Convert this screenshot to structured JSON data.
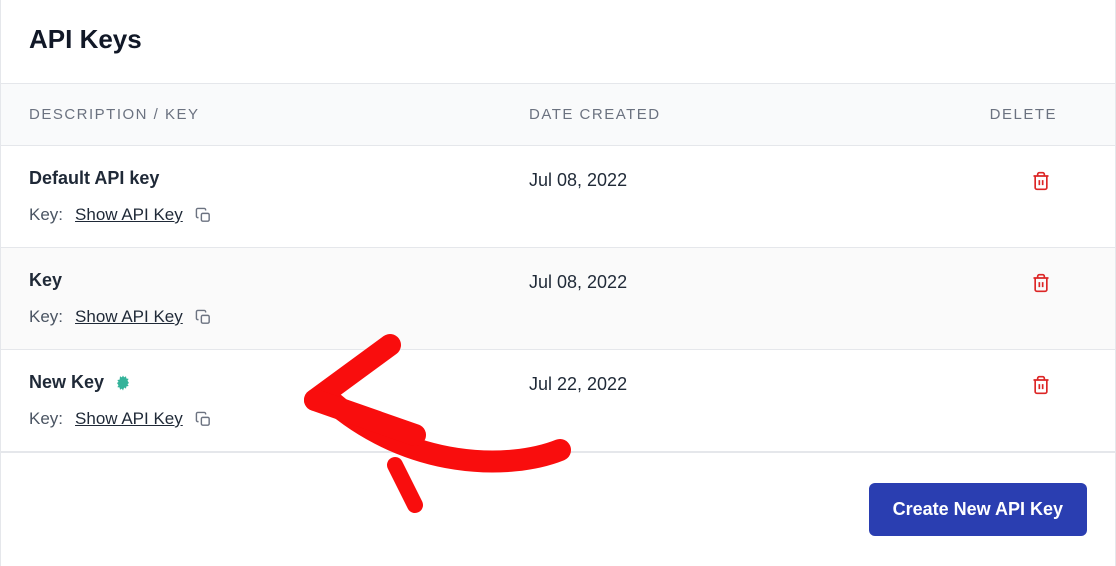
{
  "page": {
    "title": "API Keys"
  },
  "table": {
    "headers": {
      "description": "DESCRIPTION / KEY",
      "date": "DATE CREATED",
      "delete": "DELETE"
    },
    "keyLabel": "Key:",
    "showKeyLabel": "Show API Key",
    "rows": [
      {
        "title": "Default API key",
        "date": "Jul 08, 2022",
        "isNew": false
      },
      {
        "title": "Key",
        "date": "Jul 08, 2022",
        "isNew": false
      },
      {
        "title": "New Key",
        "date": "Jul 22, 2022",
        "isNew": true
      }
    ]
  },
  "actions": {
    "createNew": "Create New API Key"
  }
}
